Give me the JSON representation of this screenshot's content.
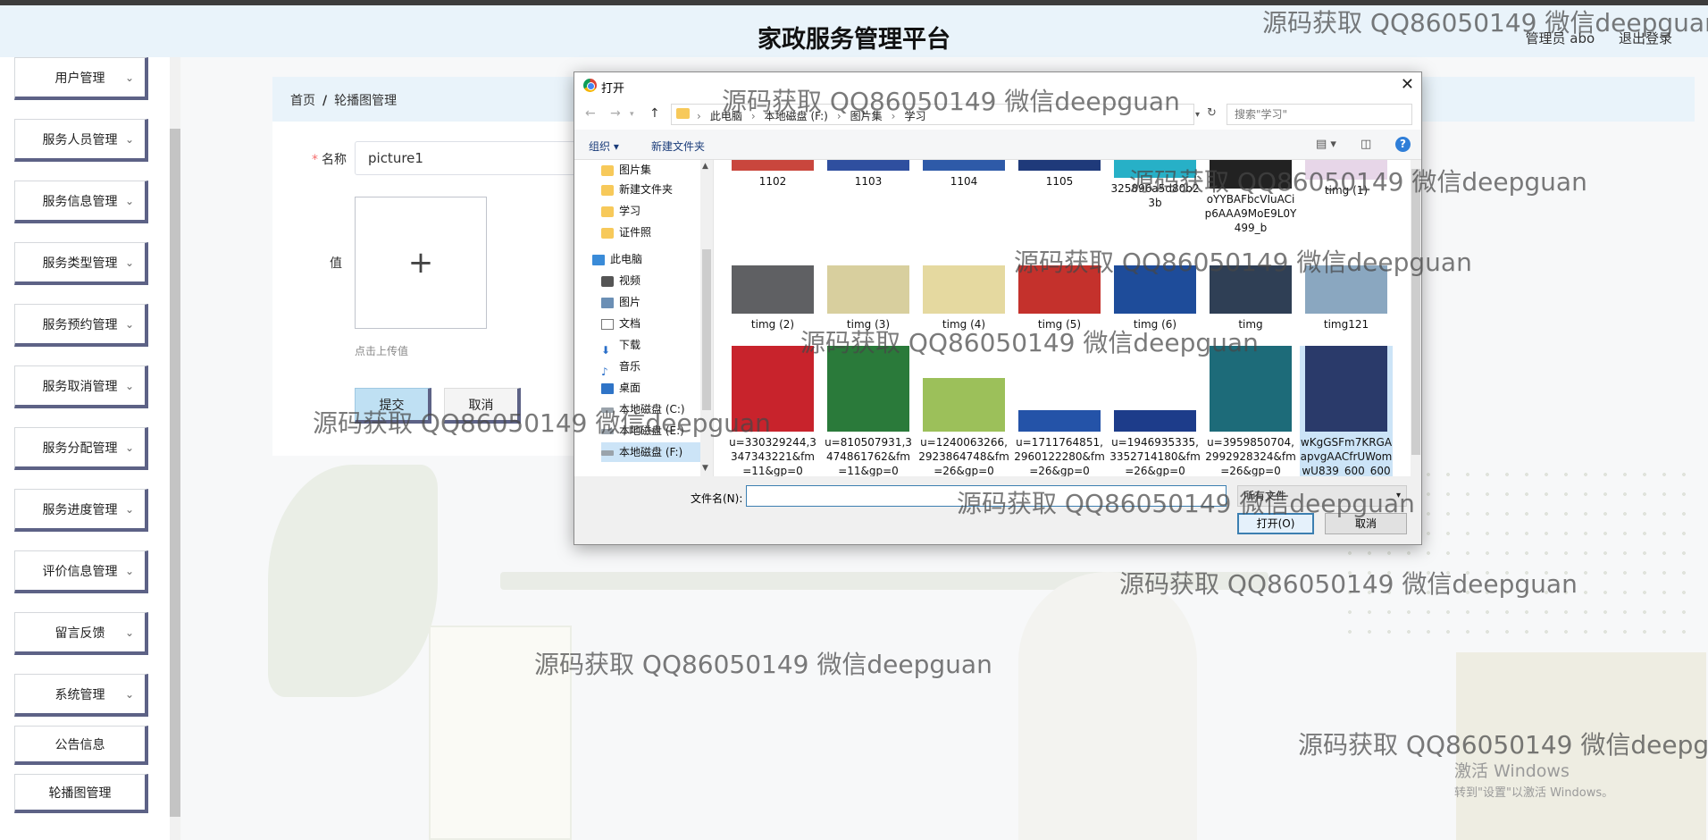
{
  "header": {
    "title": "家政服务管理平台",
    "admin_label": "管理员 abo",
    "logout_label": "退出登录"
  },
  "sidebar": {
    "items": [
      {
        "label": "用户管理"
      },
      {
        "label": "服务人员管理"
      },
      {
        "label": "服务信息管理"
      },
      {
        "label": "服务类型管理"
      },
      {
        "label": "服务预约管理"
      },
      {
        "label": "服务取消管理"
      },
      {
        "label": "服务分配管理"
      },
      {
        "label": "服务进度管理"
      },
      {
        "label": "评价信息管理"
      },
      {
        "label": "留言反馈"
      },
      {
        "label": "系统管理"
      },
      {
        "label": "公告信息"
      },
      {
        "label": "轮播图管理"
      }
    ]
  },
  "breadcrumb": {
    "home": "首页",
    "separator": "/",
    "current": "轮播图管理"
  },
  "form": {
    "name_required_mark": "*",
    "name_label": "名称",
    "name_value": "picture1",
    "value_label": "值",
    "upload_plus": "+",
    "upload_hint": "点击上传值",
    "submit_label": "提交",
    "cancel_label": "取消"
  },
  "dialog": {
    "title": "打开",
    "close": "✕",
    "address": [
      "此电脑",
      "本地磁盘 (F:)",
      "图片集",
      "学习"
    ],
    "search_placeholder": "搜索\"学习\"",
    "organize_label": "组织 ▾",
    "new_folder_label": "新建文件夹",
    "help": "?",
    "nav_items": [
      {
        "label": "图片集",
        "icon": "folder-icon"
      },
      {
        "label": "新建文件夹",
        "icon": "folder-icon"
      },
      {
        "label": "学习",
        "icon": "folder-icon"
      },
      {
        "label": "证件照",
        "icon": "folder-icon"
      },
      {
        "label": "此电脑",
        "icon": "computer-icon"
      },
      {
        "label": "视频",
        "icon": "video-icon"
      },
      {
        "label": "图片",
        "icon": "pictures-icon"
      },
      {
        "label": "文档",
        "icon": "documents-icon"
      },
      {
        "label": "下载",
        "icon": "download-icon"
      },
      {
        "label": "音乐",
        "icon": "music-icon"
      },
      {
        "label": "桌面",
        "icon": "desktop-icon"
      },
      {
        "label": "本地磁盘 (C:)",
        "icon": "drive-icon"
      },
      {
        "label": "本地磁盘 (E:)",
        "icon": "drive-icon"
      },
      {
        "label": "本地磁盘 (F:)",
        "icon": "drive-icon"
      }
    ],
    "files": [
      {
        "name": "1102",
        "thumb": "#c9463d"
      },
      {
        "name": "1103",
        "thumb": "#2f4f9f"
      },
      {
        "name": "1104",
        "thumb": "#2e5aa8"
      },
      {
        "name": "1105",
        "thumb": "#1f3a7a"
      },
      {
        "name": "325896a5d80b23b",
        "thumb": "#27b0c7"
      },
      {
        "name": "oYYBAFbcVIuACip6AAA9MoE9L0Y499_b",
        "thumb": "#222222"
      },
      {
        "name": "timg (1)",
        "thumb": "#e7d6e8"
      },
      {
        "name": "timg (2)",
        "thumb": "#5f6063"
      },
      {
        "name": "timg (3)",
        "thumb": "#d8cf9e"
      },
      {
        "name": "timg (4)",
        "thumb": "#e5d9a0"
      },
      {
        "name": "timg (5)",
        "thumb": "#c4312c"
      },
      {
        "name": "timg (6)",
        "thumb": "#1e4c9a"
      },
      {
        "name": "timg",
        "thumb": "#2f3f55"
      },
      {
        "name": "timg121",
        "thumb": "#8aa7c0"
      },
      {
        "name": "u=330329244,3347343221&fm=11&gp=0",
        "thumb": "#c8232c"
      },
      {
        "name": "u=810507931,3474861762&fm=11&gp=0",
        "thumb": "#2a7a3a"
      },
      {
        "name": "u=1240063266,2923864748&fm=26&gp=0",
        "thumb": "#9cc05a"
      },
      {
        "name": "u=1711764851,2960122280&fm=26&gp=0",
        "thumb": "#2453a8"
      },
      {
        "name": "u=1946935335,3352714180&fm=26&gp=0",
        "thumb": "#1d3c8a"
      },
      {
        "name": "u=3959850704,2992928324&fm=26&gp=0",
        "thumb": "#1d6b79"
      },
      {
        "name": "wKgGSFm7KRGAapvgAACfrUWomwU839_600_600",
        "thumb": "#2a3a6a"
      }
    ],
    "filename_label": "文件名(N):",
    "filename_value": "",
    "filetype_label": "所有文件",
    "open_label": "打开(O)",
    "cancel_label": "取消"
  },
  "watermark_text": "源码获取 QQ86050149 微信deepguan",
  "windows_activation": {
    "line1": "激活 Windows",
    "line2": "转到\"设置\"以激活 Windows。"
  }
}
